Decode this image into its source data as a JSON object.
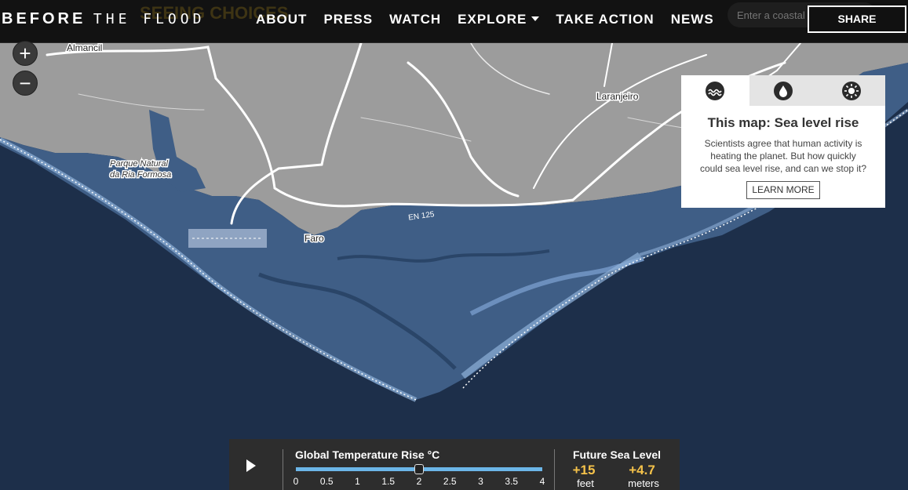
{
  "header": {
    "logo_bold": "BEFORE",
    "logo_thin": "THE FLOOD",
    "ghost_text": "SEEING CHOICES",
    "nav": [
      {
        "label": "ABOUT"
      },
      {
        "label": "PRESS"
      },
      {
        "label": "WATCH"
      },
      {
        "label": "EXPLORE"
      },
      {
        "label": "TAKE ACTION"
      },
      {
        "label": "NEWS"
      }
    ],
    "search_placeholder": "Enter a coastal city",
    "share_label": "SHARE"
  },
  "zoom": {
    "in_label": "+",
    "out_label": "−"
  },
  "map": {
    "labels": {
      "almancil": "Almancil",
      "laranjeiro": "Laranjeiro",
      "parque_line1": "Parque Natural",
      "parque_line2": "da Ria Formosa",
      "faro": "Faro",
      "road": "EN 125"
    },
    "colors": {
      "ocean": "#1d2f4a",
      "land": "#999999",
      "flood": "#3f5e86",
      "roads": "#ffffff"
    }
  },
  "info_panel": {
    "tabs": [
      {
        "icon": "wave-icon",
        "active": true
      },
      {
        "icon": "water-drop-icon",
        "active": false
      },
      {
        "icon": "sun-icon",
        "active": false
      }
    ],
    "title": "This map: Sea level rise",
    "body_line1": "Scientists agree that human activity is",
    "body_line2": "heating the planet. But how quickly",
    "body_line3": "could sea level rise, and can we stop it?",
    "button": "LEARN MORE"
  },
  "controls": {
    "slider_title": "Global Temperature Rise °C",
    "ticks": [
      "0",
      "0.5",
      "1",
      "1.5",
      "2",
      "2.5",
      "3",
      "3.5",
      "4"
    ],
    "slider_value": 2,
    "slider_min": 0,
    "slider_max": 4,
    "sea_title": "Future Sea Level",
    "feet_value": "+15",
    "feet_unit": "feet",
    "meters_value": "+4.7",
    "meters_unit": "meters",
    "accent": "#f5c24a",
    "track_color": "#6cb6e8"
  }
}
